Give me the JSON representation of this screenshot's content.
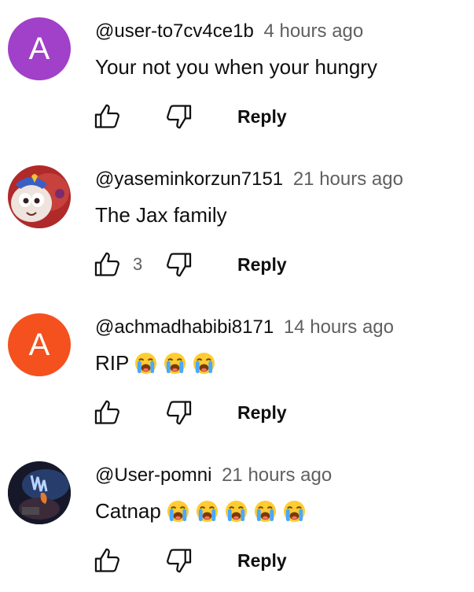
{
  "comments": [
    {
      "handle": "@user-to7cv4ce1b",
      "time": "4 hours ago",
      "text": "Your not you when your hungry",
      "avatar_letter": "A",
      "avatar_color": "#a140c8",
      "likes": "",
      "reply_label": "Reply",
      "emoji_count": 0
    },
    {
      "handle": "@yaseminkorzun7151",
      "time": "21 hours ago",
      "text": "The Jax family",
      "avatar_letter": "",
      "avatar_color": "#c33d3d",
      "likes": "3",
      "reply_label": "Reply",
      "emoji_count": 0
    },
    {
      "handle": "@achmadhabibi8171",
      "time": "14 hours ago",
      "text": "RIP",
      "avatar_letter": "A",
      "avatar_color": "#f4511e",
      "likes": "",
      "reply_label": "Reply",
      "emoji_count": 3
    },
    {
      "handle": "@User-pomni",
      "time": "21 hours ago",
      "text": "Catnap",
      "avatar_letter": "",
      "avatar_color": "#1a1d2e",
      "likes": "",
      "reply_label": "Reply",
      "emoji_count": 5
    }
  ],
  "emoji_name": "loudly-crying-face",
  "colors": {
    "text": "#0f0f0f",
    "secondary": "#606060"
  }
}
